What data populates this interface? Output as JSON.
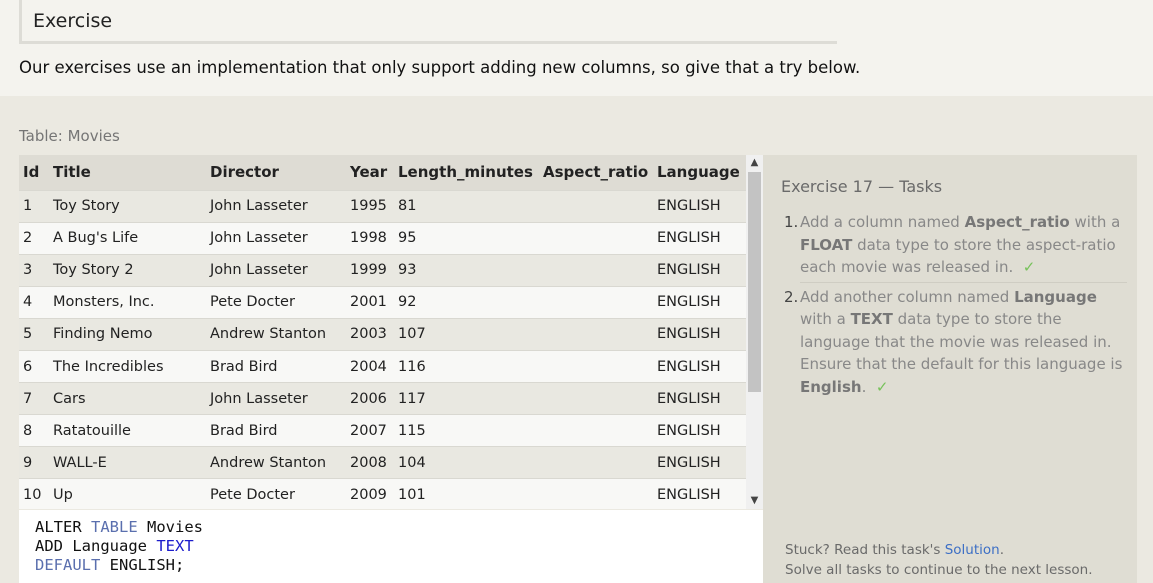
{
  "exercise": {
    "heading": "Exercise",
    "intro": "Our exercises use an implementation that only support adding new columns, so give that a try below."
  },
  "table": {
    "caption": "Table: Movies",
    "columns": [
      "Id",
      "Title",
      "Director",
      "Year",
      "Length_minutes",
      "Aspect_ratio",
      "Language"
    ],
    "rows": [
      [
        "1",
        "Toy Story",
        "John Lasseter",
        "1995",
        "81",
        "",
        "ENGLISH"
      ],
      [
        "2",
        "A Bug's Life",
        "John Lasseter",
        "1998",
        "95",
        "",
        "ENGLISH"
      ],
      [
        "3",
        "Toy Story 2",
        "John Lasseter",
        "1999",
        "93",
        "",
        "ENGLISH"
      ],
      [
        "4",
        "Monsters, Inc.",
        "Pete Docter",
        "2001",
        "92",
        "",
        "ENGLISH"
      ],
      [
        "5",
        "Finding Nemo",
        "Andrew Stanton",
        "2003",
        "107",
        "",
        "ENGLISH"
      ],
      [
        "6",
        "The Incredibles",
        "Brad Bird",
        "2004",
        "116",
        "",
        "ENGLISH"
      ],
      [
        "7",
        "Cars",
        "John Lasseter",
        "2006",
        "117",
        "",
        "ENGLISH"
      ],
      [
        "8",
        "Ratatouille",
        "Brad Bird",
        "2007",
        "115",
        "",
        "ENGLISH"
      ],
      [
        "9",
        "WALL-E",
        "Andrew Stanton",
        "2008",
        "104",
        "",
        "ENGLISH"
      ],
      [
        "10",
        "Up",
        "Pete Docter",
        "2009",
        "101",
        "",
        "ENGLISH"
      ]
    ]
  },
  "editor": {
    "line1": {
      "a": "ALTER ",
      "b": "TABLE",
      "c": " Movies"
    },
    "line2": {
      "a": "ADD Language ",
      "b": "TEXT"
    },
    "line3": {
      "a": "DEFAULT",
      "b": " ENGLISH;"
    }
  },
  "tasks": {
    "title": "Exercise 17 — Tasks",
    "items": [
      {
        "num": "1.",
        "t1": "Add a column named ",
        "b1": "Aspect_ratio",
        "t2": " with a ",
        "b2": "FLOAT",
        "t3": " data type to store the aspect-ratio each movie was released in.",
        "check": "✓"
      },
      {
        "num": "2.",
        "t1": "Add another column named ",
        "b1": "Language",
        "t2": " with a ",
        "b2": "TEXT",
        "t3": " data type to store the language that the movie was released in. Ensure that the default for this language is ",
        "b3": "English",
        "t4": ".",
        "check": "✓"
      }
    ],
    "stuck_prefix": "Stuck? Read this task's ",
    "stuck_link": "Solution",
    "stuck_suffix": ".",
    "solve_note": "Solve all tasks to continue to the next lesson."
  },
  "scrollbar": {
    "up_icon": "chevron-up-icon",
    "down_icon": "chevron-down-icon"
  }
}
